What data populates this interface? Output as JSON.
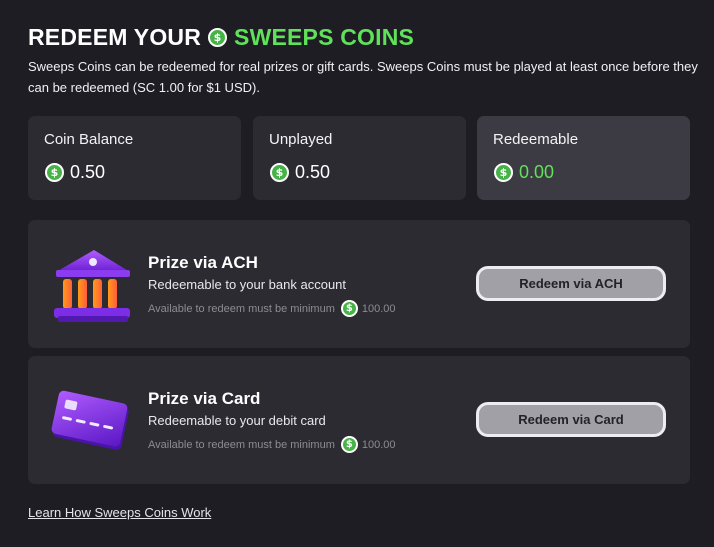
{
  "header": {
    "title_prefix": "REDEEM YOUR",
    "title_highlight": "SWEEPS COINS",
    "description": "Sweeps Coins can be redeemed for real prizes or gift cards. Sweeps Coins must be played at least once before they can be redeemed (SC 1.00 for $1 USD)."
  },
  "coin_symbol": "$",
  "stats": [
    {
      "label": "Coin Balance",
      "value": "0.50"
    },
    {
      "label": "Unplayed",
      "value": "0.50"
    },
    {
      "label": "Redeemable",
      "value": "0.00"
    }
  ],
  "options": [
    {
      "title": "Prize via ACH",
      "subtitle": "Redeemable to your bank account",
      "minimum_text": "Available to redeem must be minimum",
      "minimum_value": "100.00",
      "button_label": "Redeem via ACH",
      "icon": "bank-icon"
    },
    {
      "title": "Prize via Card",
      "subtitle": "Redeemable to your debit card",
      "minimum_text": "Available to redeem must be minimum",
      "minimum_value": "100.00",
      "button_label": "Redeem via Card",
      "icon": "card-icon"
    }
  ],
  "learn_link": "Learn How Sweeps Coins Work",
  "colors": {
    "background": "#1e1d24",
    "panel": "#2c2b32",
    "accent_green": "#5fe15a",
    "coin_green": "#46b347",
    "button": "#a1a0a7"
  }
}
